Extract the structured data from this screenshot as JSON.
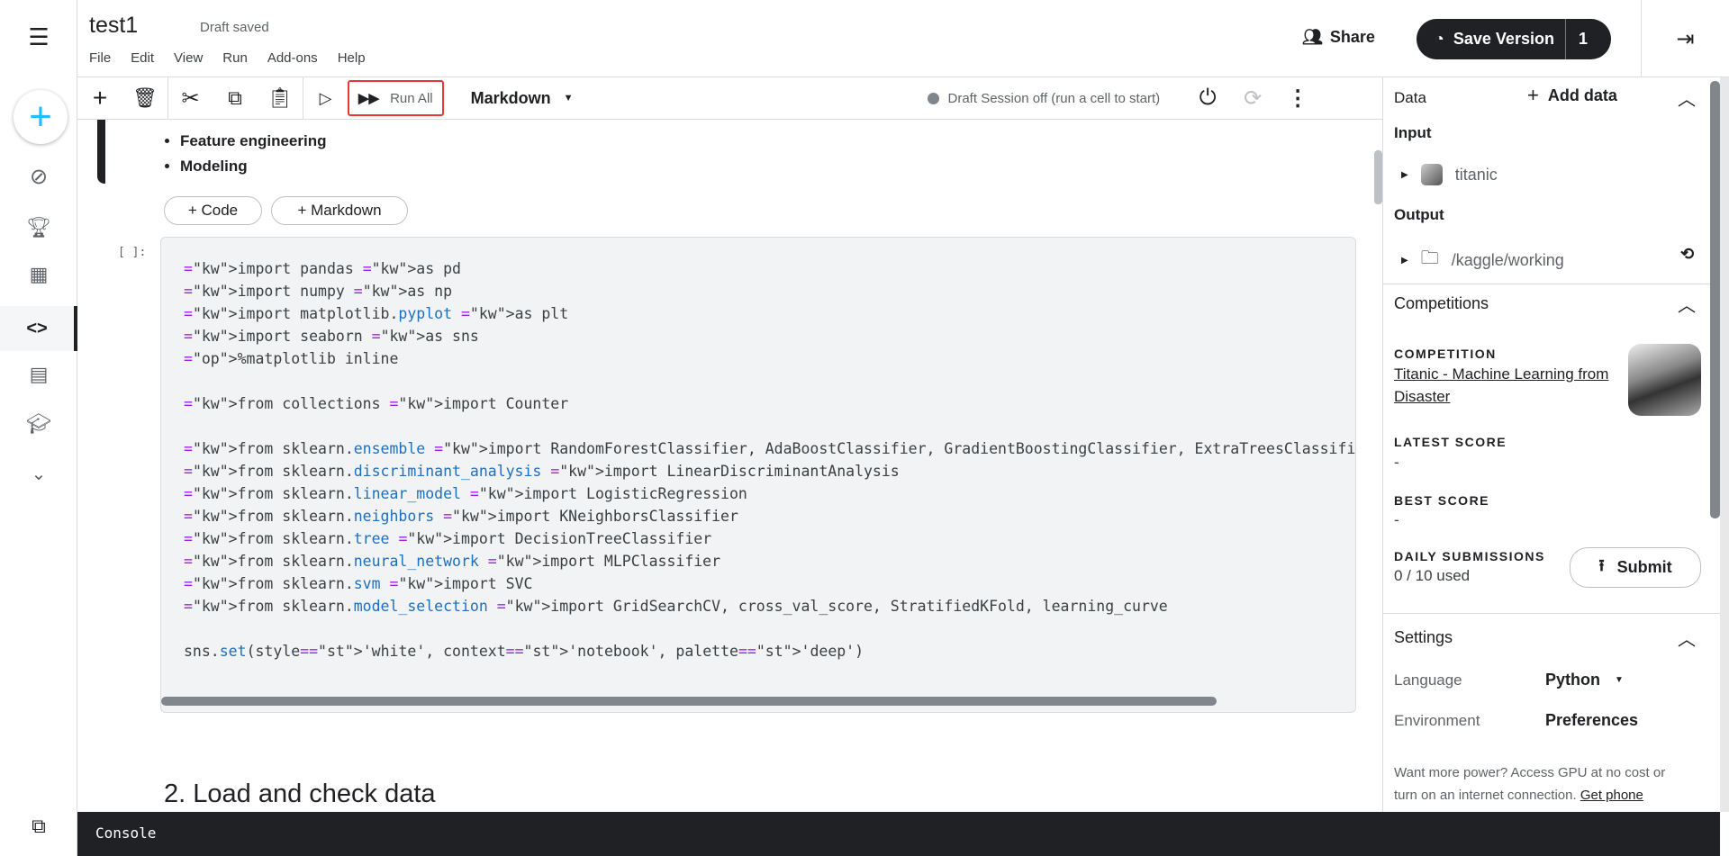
{
  "notebook": {
    "title": "test1",
    "status": "Draft saved",
    "menu": [
      "File",
      "Edit",
      "View",
      "Run",
      "Add-ons",
      "Help"
    ]
  },
  "header": {
    "share": "Share",
    "save_version": "Save Version",
    "version_count": "1"
  },
  "toolbar": {
    "run_all": "Run All",
    "cell_type": "Markdown",
    "session_status": "Draft Session off (run a cell to start)"
  },
  "cells": {
    "bullets": [
      "Feature engineering",
      "Modeling"
    ],
    "add_code": "+ Code",
    "add_markdown": "+ Markdown",
    "prompt": "[ ]:",
    "code_lines": [
      "import pandas as pd",
      "import numpy as np",
      "import matplotlib.pyplot as plt",
      "import seaborn as sns",
      "%matplotlib inline",
      "",
      "from collections import Counter",
      "",
      "from sklearn.ensemble import RandomForestClassifier, AdaBoostClassifier, GradientBoostingClassifier, ExtraTreesClassifier, V",
      "from sklearn.discriminant_analysis import LinearDiscriminantAnalysis",
      "from sklearn.linear_model import LogisticRegression",
      "from sklearn.neighbors import KNeighborsClassifier",
      "from sklearn.tree import DecisionTreeClassifier",
      "from sklearn.neural_network import MLPClassifier",
      "from sklearn.svm import SVC",
      "from sklearn.model_selection import GridSearchCV, cross_val_score, StratifiedKFold, learning_curve",
      "",
      "sns.set(style='white', context='notebook', palette='deep')"
    ],
    "heading": "2. Load and check data"
  },
  "right_panel": {
    "data_title": "Data",
    "add_data": "Add data",
    "input_label": "Input",
    "input_item": "titanic",
    "output_label": "Output",
    "output_item": "/kaggle/working",
    "competitions_title": "Competitions",
    "competition_label": "COMPETITION",
    "competition_link": "Titanic - Machine Learning from Disaster",
    "latest_score_label": "LATEST SCORE",
    "latest_score": "-",
    "best_score_label": "BEST SCORE",
    "best_score": "-",
    "daily_label": "DAILY SUBMISSIONS",
    "daily_value": "0 / 10 used",
    "submit": "Submit",
    "settings_title": "Settings",
    "language_label": "Language",
    "language_value": "Python",
    "environment_label": "Environment",
    "environment_value": "Preferences",
    "power_text": "Want more power? Access GPU at no cost or turn on an internet connection.",
    "power_link": "Get phone"
  },
  "console": {
    "label": "Console"
  },
  "colors": {
    "accent": "#20beff",
    "highlight": "#e53935",
    "dark": "#202124"
  }
}
